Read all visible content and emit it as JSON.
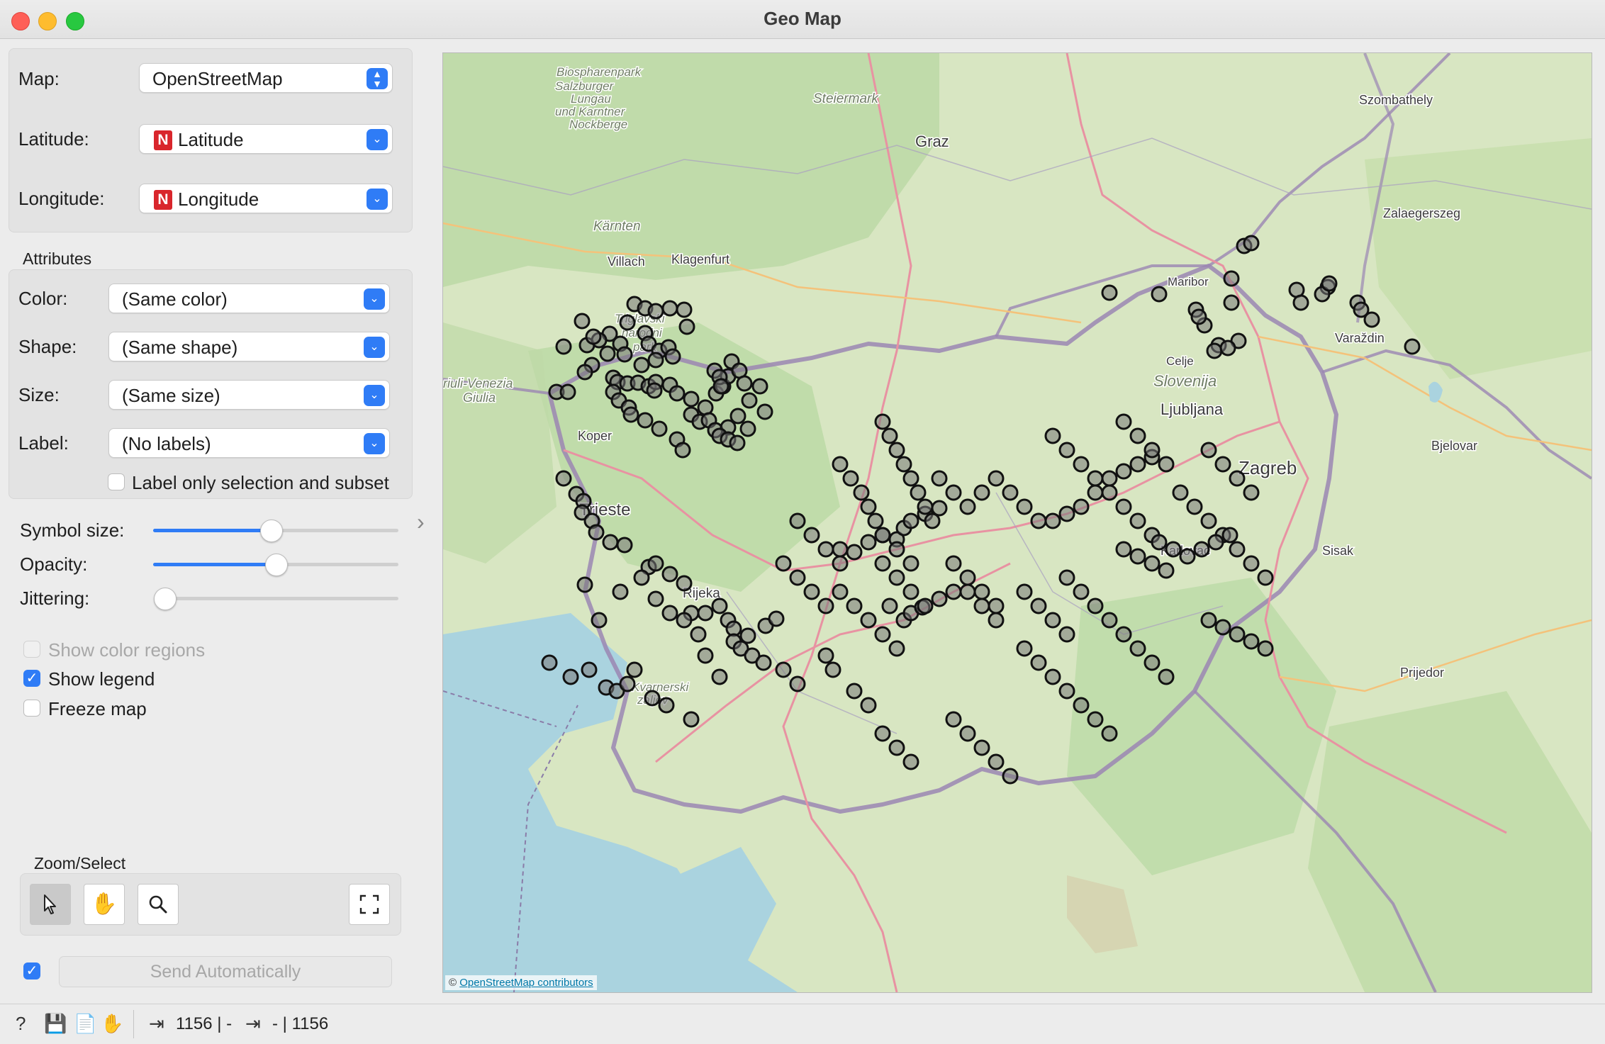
{
  "window": {
    "title": "Geo Map"
  },
  "map_settings": {
    "map_label": "Map:",
    "map_value": "OpenStreetMap",
    "latitude_label": "Latitude:",
    "latitude_value": "Latitude",
    "longitude_label": "Longitude:",
    "longitude_value": "Longitude",
    "numeric_badge": "N"
  },
  "attributes": {
    "section_title": "Attributes",
    "color_label": "Color:",
    "color_value": "(Same color)",
    "shape_label": "Shape:",
    "shape_value": "(Same shape)",
    "size_label": "Size:",
    "size_value": "(Same size)",
    "label_label": "Label:",
    "label_value": "(No labels)",
    "label_only_selection": "Label only selection and subset",
    "label_only_selection_checked": false
  },
  "sliders": {
    "symbol_size_label": "Symbol size:",
    "symbol_size_value": 0.48,
    "opacity_label": "Opacity:",
    "opacity_value": 0.5,
    "jittering_label": "Jittering:",
    "jittering_value": 0.0
  },
  "options": {
    "show_color_regions": "Show color regions",
    "show_color_regions_checked": false,
    "show_legend": "Show legend",
    "show_legend_checked": true,
    "freeze_map": "Freeze map",
    "freeze_map_checked": false
  },
  "zoom_select": {
    "title": "Zoom/Select"
  },
  "send": {
    "label": "Send Automatically",
    "auto_checked": true
  },
  "map": {
    "attribution_symbol": "©",
    "attribution": "OpenStreetMap contributors",
    "place_labels": [
      {
        "name": "Biospharenpark",
        "italic": true
      },
      {
        "name": "Salzburger",
        "italic": true
      },
      {
        "name": "Lungau",
        "italic": true
      },
      {
        "name": "und Karntner",
        "italic": true
      },
      {
        "name": "Nockberge",
        "italic": true
      },
      {
        "name": "Steiermark",
        "italic": true
      },
      {
        "name": "Graz",
        "italic": false
      },
      {
        "name": "Szombathely",
        "italic": false
      },
      {
        "name": "Zalaegerszeg",
        "italic": false
      },
      {
        "name": "Kärnten",
        "italic": true
      },
      {
        "name": "Villach",
        "italic": false
      },
      {
        "name": "Klagenfurt",
        "italic": false
      },
      {
        "name": "Maribor",
        "italic": false
      },
      {
        "name": "Triglavski",
        "italic": true
      },
      {
        "name": "narodni",
        "italic": true
      },
      {
        "name": "park",
        "italic": true
      },
      {
        "name": "Varaždin",
        "italic": false
      },
      {
        "name": "Celje",
        "italic": false
      },
      {
        "name": "riuli-Venezia",
        "italic": true
      },
      {
        "name": "Giulia",
        "italic": true
      },
      {
        "name": "Slovenija",
        "italic": true
      },
      {
        "name": "Ljubljana",
        "italic": false
      },
      {
        "name": "Bjelovar",
        "italic": false
      },
      {
        "name": "Zagreb",
        "italic": false
      },
      {
        "name": "Trieste",
        "italic": false
      },
      {
        "name": "Karlovac",
        "italic": false
      },
      {
        "name": "Sisak",
        "italic": false
      },
      {
        "name": "Rijeka",
        "italic": false
      },
      {
        "name": "Prijedor",
        "italic": false
      },
      {
        "name": "Kvarnerski",
        "italic": true
      },
      {
        "name": "zaljev",
        "italic": true
      },
      {
        "name": "Koper",
        "italic": false
      }
    ]
  },
  "status": {
    "input_count": "1156 | -",
    "output_count": "- | 1156"
  }
}
